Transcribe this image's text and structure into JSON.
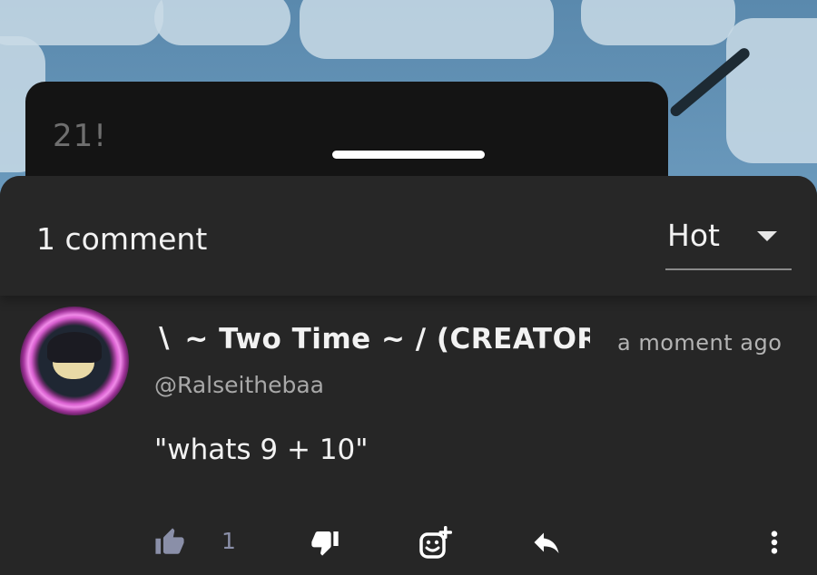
{
  "previous_post": {
    "text": "21!"
  },
  "comments_sheet": {
    "count_label": "1 comment",
    "sort": {
      "selected": "Hot"
    }
  },
  "comment": {
    "author": "∖ ~ Two Time ~ ∕ (CREATOR",
    "timestamp": "a moment ago",
    "handle": "@Ralseithebaa",
    "body": "\"whats 9 + 10\"",
    "like_count": "1",
    "actions": {
      "like_icon": "thumbs-up-icon",
      "dislike_icon": "thumbs-down-icon",
      "react_icon": "add-reaction-icon",
      "reply_icon": "reply-icon",
      "more_icon": "more-vertical-icon"
    }
  },
  "colors": {
    "sheet_bg": "#262626",
    "text_primary": "#f2f2f2",
    "text_secondary": "#a8a8a8",
    "action_icon": "#8a8fa8",
    "avatar_ring": "#d85fcf"
  }
}
